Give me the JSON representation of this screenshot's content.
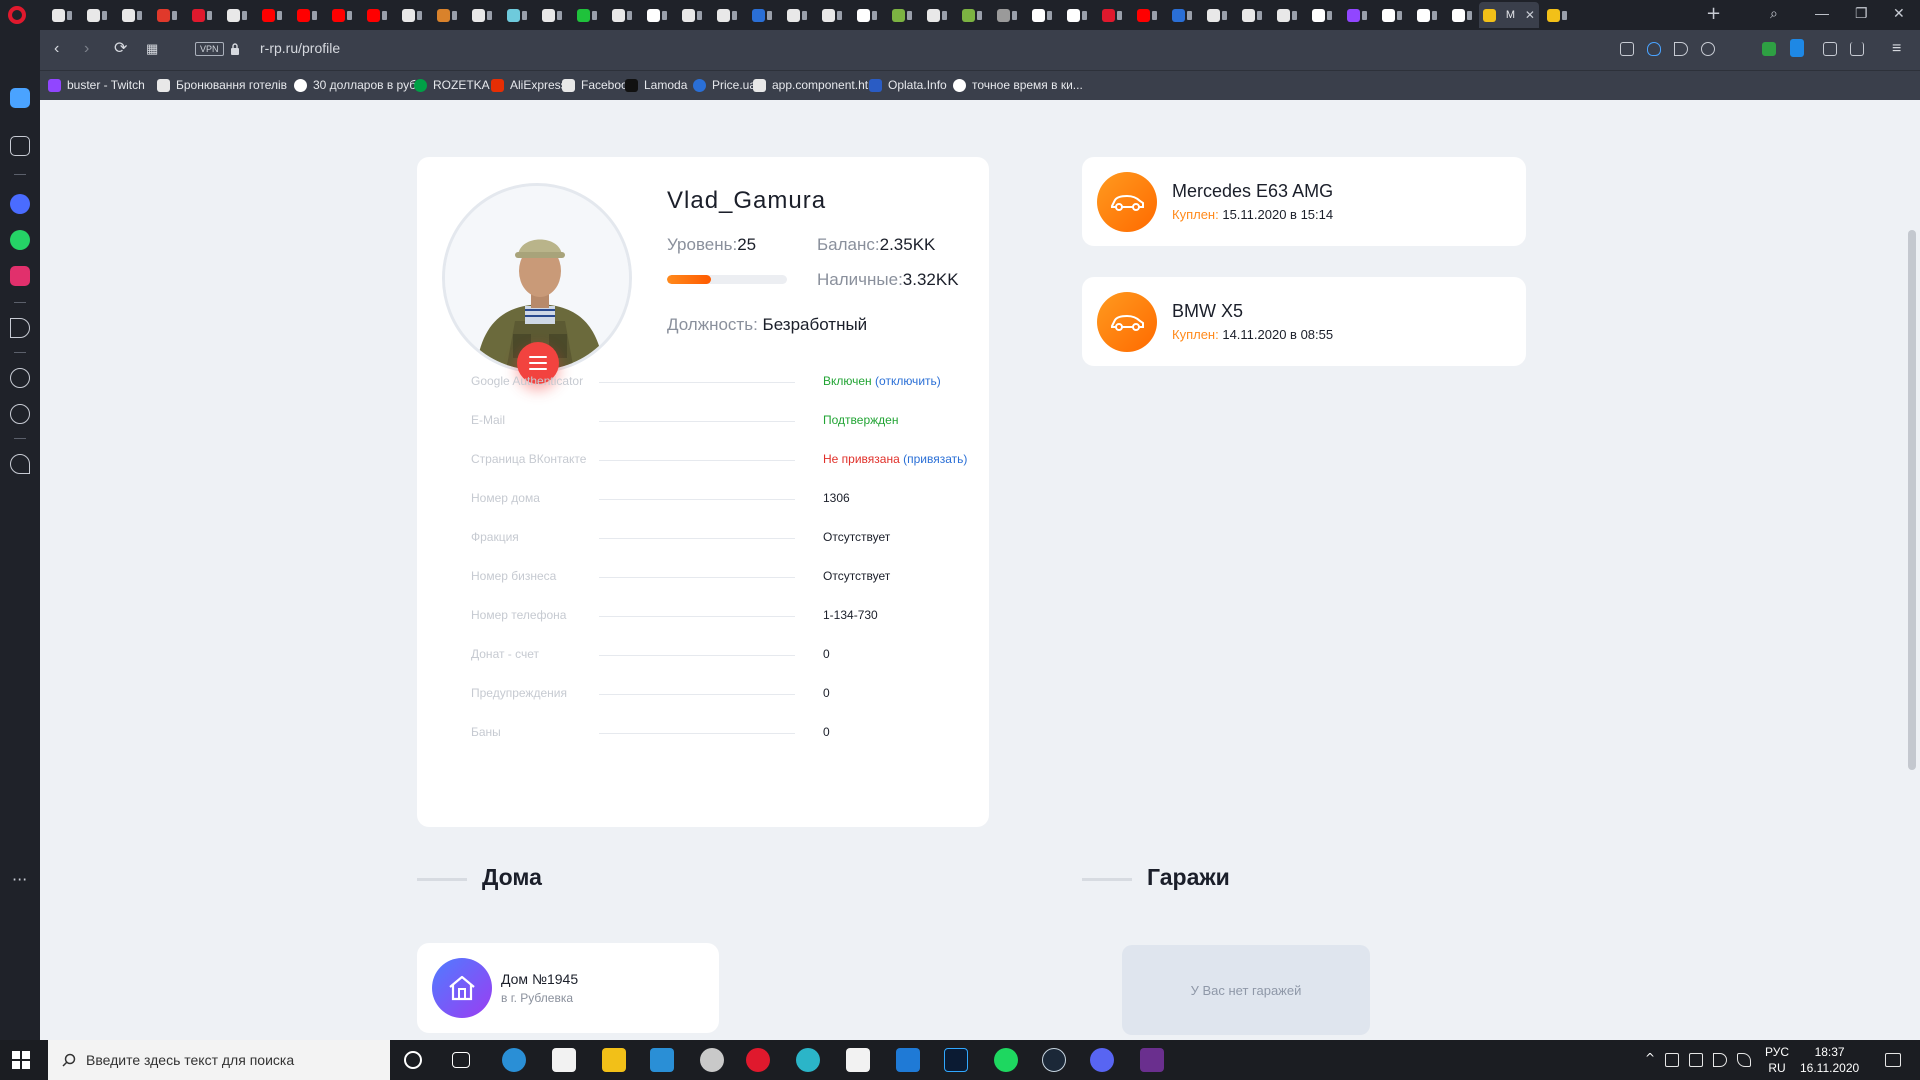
{
  "browser": {
    "active_tab_label": "M",
    "tabs": [
      {
        "icon": "notepad-icon",
        "color": "#e8e8e8"
      },
      {
        "icon": "document-icon",
        "color": "#e8e8e8"
      },
      {
        "icon": "notepad-icon",
        "color": "#e8e8e8"
      },
      {
        "icon": "fx-icon",
        "color": "#e0392b"
      },
      {
        "icon": "f-logo-icon",
        "color": "#e0192d"
      },
      {
        "icon": "document-icon",
        "color": "#e8e8e8"
      },
      {
        "icon": "youtube-icon",
        "color": "#ff0000"
      },
      {
        "icon": "youtube-icon",
        "color": "#ff0000"
      },
      {
        "icon": "youtube-icon",
        "color": "#ff0000"
      },
      {
        "icon": "youtube-icon",
        "color": "#ff0000"
      },
      {
        "icon": "document-icon",
        "color": "#e8e8e8"
      },
      {
        "icon": "cookie-icon",
        "color": "#d9822b"
      },
      {
        "icon": "document-icon",
        "color": "#e8e8e8"
      },
      {
        "icon": "slack-icon",
        "color": "#6ecadc"
      },
      {
        "icon": "document-icon",
        "color": "#e8e8e8"
      },
      {
        "icon": "t-icon",
        "color": "#1fc23b"
      },
      {
        "icon": "document-icon",
        "color": "#e8e8e8"
      },
      {
        "icon": "google-icon",
        "color": "#ffffff"
      },
      {
        "icon": "notepad-icon",
        "color": "#e8e8e8"
      },
      {
        "icon": "document-icon",
        "color": "#e8e8e8"
      },
      {
        "icon": "mail-icon",
        "color": "#2a6fd6"
      },
      {
        "icon": "document-icon",
        "color": "#e8e8e8"
      },
      {
        "icon": "document-icon",
        "color": "#e8e8e8"
      },
      {
        "icon": "google-icon",
        "color": "#ffffff"
      },
      {
        "icon": "android-icon",
        "color": "#7cb342"
      },
      {
        "icon": "notepad-icon",
        "color": "#e8e8e8"
      },
      {
        "icon": "android-icon",
        "color": "#7cb342"
      },
      {
        "icon": "game-icon",
        "color": "#9a9a9a"
      },
      {
        "icon": "google-icon",
        "color": "#ffffff"
      },
      {
        "icon": "google-icon",
        "color": "#ffffff"
      },
      {
        "icon": "target-icon",
        "color": "#e0192d"
      },
      {
        "icon": "youtube-icon",
        "color": "#ff0000"
      },
      {
        "icon": "flag-icon",
        "color": "#2a6fd6"
      },
      {
        "icon": "document-icon",
        "color": "#e8e8e8"
      },
      {
        "icon": "notepad-icon",
        "color": "#e8e8e8"
      },
      {
        "icon": "notepad-icon",
        "color": "#e8e8e8"
      },
      {
        "icon": "google-icon",
        "color": "#ffffff"
      },
      {
        "icon": "twitch-icon",
        "color": "#9146ff"
      },
      {
        "icon": "wikipedia-icon",
        "color": "#ffffff"
      },
      {
        "icon": "wikipedia-icon",
        "color": "#ffffff"
      },
      {
        "icon": "google-icon",
        "color": "#ffffff"
      },
      {
        "icon": "p-icon",
        "color": "#f2c018"
      }
    ],
    "url": "r-rp.ru/profile",
    "vpn_label": "VPN",
    "bookmarks": [
      {
        "label": "buster - Twitch",
        "icon": "twitch-icon",
        "color": "#9146ff"
      },
      {
        "label": "Бронювання готелів",
        "icon": "document-icon",
        "color": "#e8e8e8"
      },
      {
        "label": "30 долларов в руб...",
        "icon": "google-icon",
        "color": "#ffffff"
      },
      {
        "label": "ROZETKA",
        "icon": "rozetka-icon",
        "color": "#00a046"
      },
      {
        "label": "AliExpress",
        "icon": "aliexpress-icon",
        "color": "#e62e04"
      },
      {
        "label": "Facebook",
        "icon": "document-icon",
        "color": "#e8e8e8"
      },
      {
        "label": "Lamoda",
        "icon": "lamoda-icon",
        "color": "#111111"
      },
      {
        "label": "Price.ua",
        "icon": "price-icon",
        "color": "#2a6fd6"
      },
      {
        "label": "app.component.html",
        "icon": "document-icon",
        "color": "#e8e8e8"
      },
      {
        "label": "Oplata.Info",
        "icon": "oplata-icon",
        "color": "#2a5cc4"
      },
      {
        "label": "точное время в ки...",
        "icon": "google-icon",
        "color": "#ffffff"
      }
    ]
  },
  "profile": {
    "player_name": "Vlad_Gamura",
    "level_label": "Уровень:",
    "level_value": "25",
    "level_progress": 0.37,
    "balance_label": "Баланс:",
    "balance_value": "2.35KK",
    "cash_label": "Наличные:",
    "cash_value": "3.32KK",
    "position_label": "Должность:",
    "position_value": "Безработный",
    "info_rows": [
      {
        "label": "Google Authenticator",
        "value": "Включен",
        "status": "green",
        "link": "отключить"
      },
      {
        "label": "E-Mail",
        "value": "Подтвержден",
        "status": "green",
        "link": ""
      },
      {
        "label": "Страница ВКонтакте",
        "value": "Не привязана",
        "status": "red",
        "link": "привязать"
      },
      {
        "label": "Номер дома",
        "value": "1306",
        "status": "",
        "link": ""
      },
      {
        "label": "Фракция",
        "value": "Отсутствует",
        "status": "",
        "link": ""
      },
      {
        "label": "Номер бизнеса",
        "value": "Отсутствует",
        "status": "",
        "link": ""
      },
      {
        "label": "Номер телефона",
        "value": "1-134-730",
        "status": "",
        "link": ""
      },
      {
        "label": "Донат - счет",
        "value": "0",
        "status": "",
        "link": ""
      },
      {
        "label": "Предупреждения",
        "value": "0",
        "status": "",
        "link": ""
      },
      {
        "label": "Баны",
        "value": "0",
        "status": "",
        "link": ""
      }
    ]
  },
  "cars": [
    {
      "name": "Mercedes E63 AMG",
      "bought_label": "Куплен:",
      "bought_date": "15.11.2020 в 15:14"
    },
    {
      "name": "BMW X5",
      "bought_label": "Куплен:",
      "bought_date": "14.11.2020 в 08:55"
    }
  ],
  "sections": {
    "houses_title": "Дома",
    "garages_title": "Гаражи"
  },
  "house": {
    "name": "Дом №1945",
    "city": "в г. Рублевка"
  },
  "garages": {
    "empty_text": "У Вас нет гаражей"
  },
  "taskbar": {
    "search_placeholder": "Введите здесь текст для поиска",
    "lang_primary": "РУС",
    "lang_secondary": "RU",
    "time": "18:37",
    "date": "16.11.2020"
  }
}
